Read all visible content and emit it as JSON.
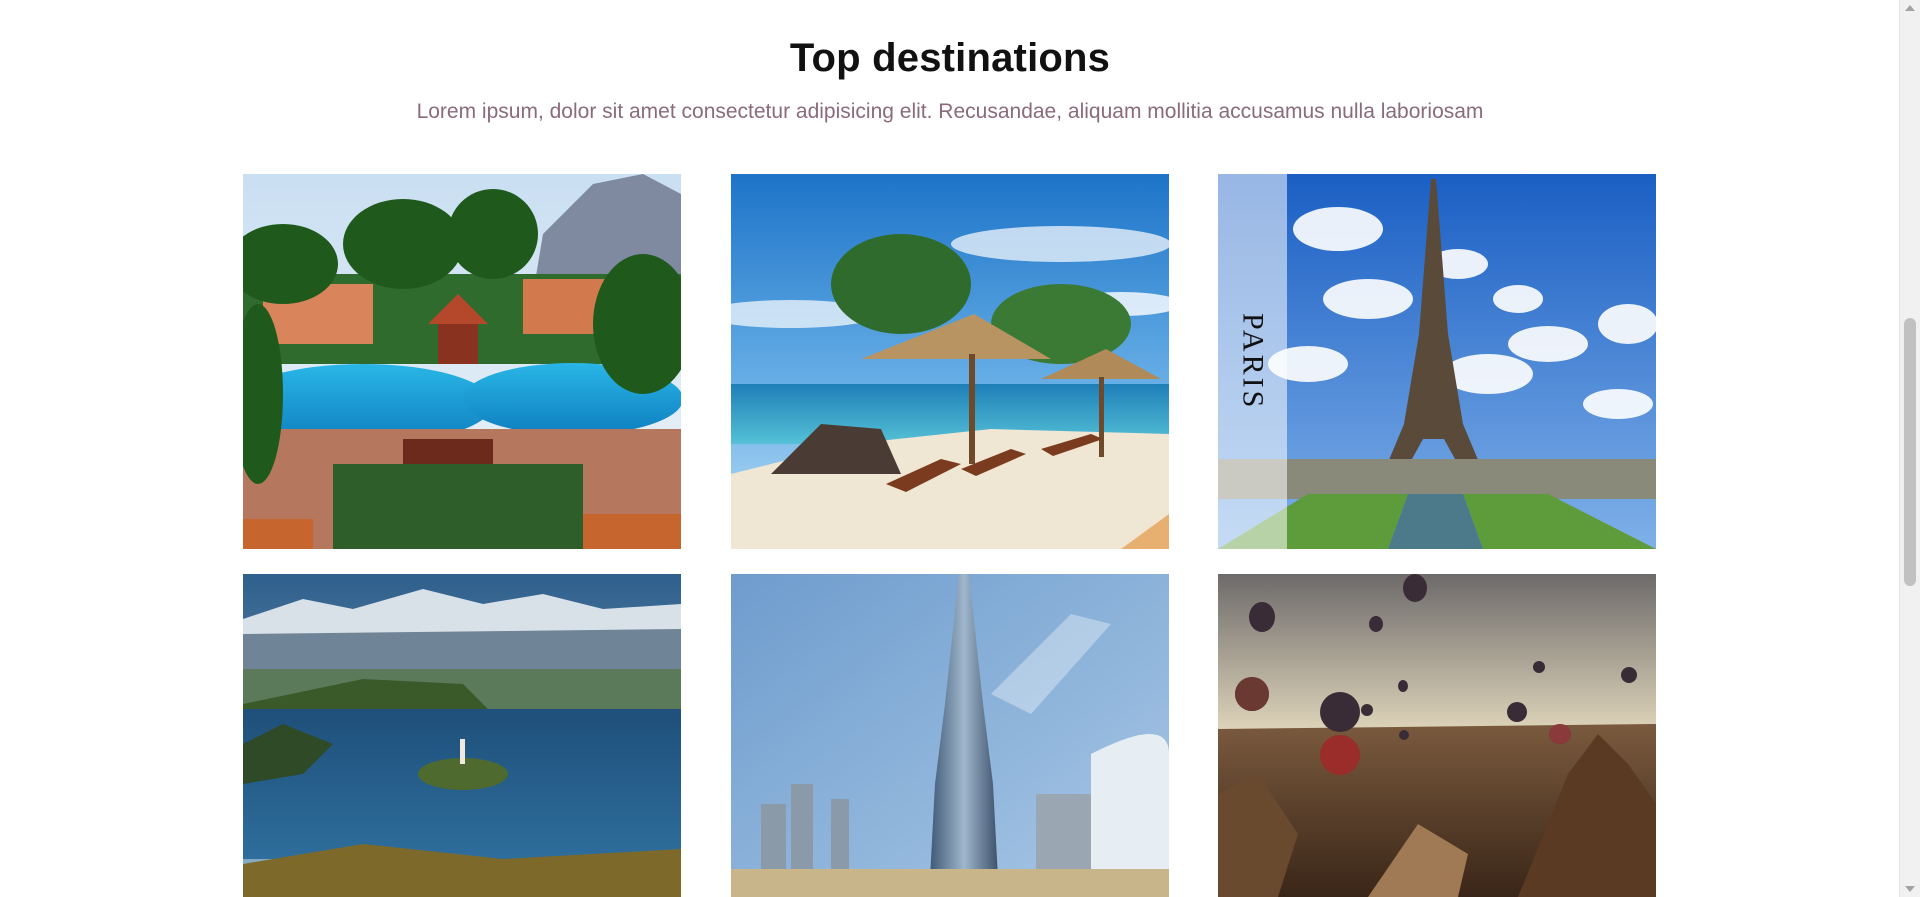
{
  "section": {
    "title": "Top destinations",
    "subtitle": "Lorem ipsum, dolor sit amet consectetur adipisicing elit. Recusandae, aliquam mollitia accusamus nulla laboriosam"
  },
  "destinations": [
    {
      "scene": "tropical-resort-pool"
    },
    {
      "scene": "beach-with-thatched-umbrellas"
    },
    {
      "scene": "eiffel-tower",
      "label": "PARIS"
    },
    {
      "scene": "lake-with-island-and-mountains"
    },
    {
      "scene": "skyscraper-city"
    },
    {
      "scene": "hot-air-balloons-over-canyon"
    }
  ],
  "colors": {
    "title": "#111111",
    "subtitle": "#8a6b7c",
    "background": "#ffffff"
  }
}
